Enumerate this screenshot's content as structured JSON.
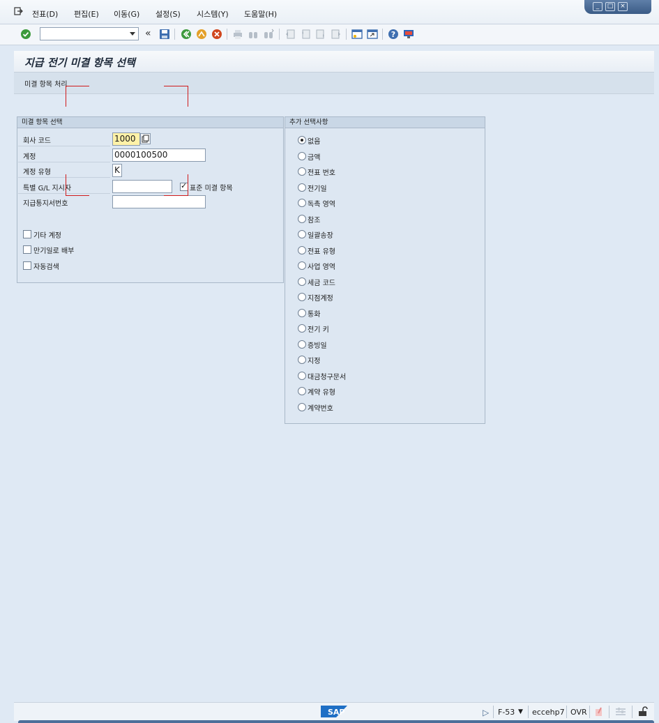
{
  "menu": [
    "전표(D)",
    "편집(E)",
    "이동(G)",
    "설정(S)",
    "시스템(Y)",
    "도움말(H)"
  ],
  "toolbar": {
    "command_value": "",
    "icons": [
      "enter-icon",
      "back-icon",
      "save-icon",
      "back-green-icon",
      "exit-icon",
      "cancel-icon",
      "print-icon",
      "find-icon",
      "find-next-icon",
      "first-page-icon",
      "prev-page-icon",
      "next-page-icon",
      "last-page-icon",
      "new-session-icon",
      "shortcut-icon",
      "help-icon",
      "customize-icon"
    ]
  },
  "title": "지급 전기 미결 항목 선택",
  "apptool": {
    "process_open_items": "미결 항목 처리"
  },
  "open_item_selection": {
    "title": "미결 항목 선택",
    "company_code_label": "회사 코드",
    "company_code_value": "1000",
    "account_label": "계정",
    "account_value": "0000100500",
    "account_type_label": "계정 유형",
    "account_type_value": "K",
    "special_gl_label": "특별 G/L 지시자",
    "special_gl_value": "",
    "standard_oi_label": "표준 미결 항목",
    "standard_oi_checked": true,
    "payment_advice_label": "지급통지서번호",
    "payment_advice_value": "",
    "other_accounts_label": "기타 계정",
    "distribute_by_age_label": "만기일로 배부",
    "automatic_search_label": "자동검색"
  },
  "additional_selections": {
    "title": "추가 선택사항",
    "options": [
      "없음",
      "금액",
      "전표 번호",
      "전기일",
      "독촉 영역",
      "참조",
      "일괄송장",
      "전표 유형",
      "사업 영역",
      "세금 코드",
      "지점계정",
      "통화",
      "전기 키",
      "증빙일",
      "지정",
      "대금청구문서",
      "계약 유형",
      "계약번호"
    ],
    "selected_index": 0
  },
  "status": {
    "transaction": "F-53",
    "system": "ecc​ehp7",
    "mode": "OVR"
  },
  "colors": {
    "accent": "#3a5b86",
    "field_required": "#fff2a8",
    "annotation": "#d01a1a"
  }
}
